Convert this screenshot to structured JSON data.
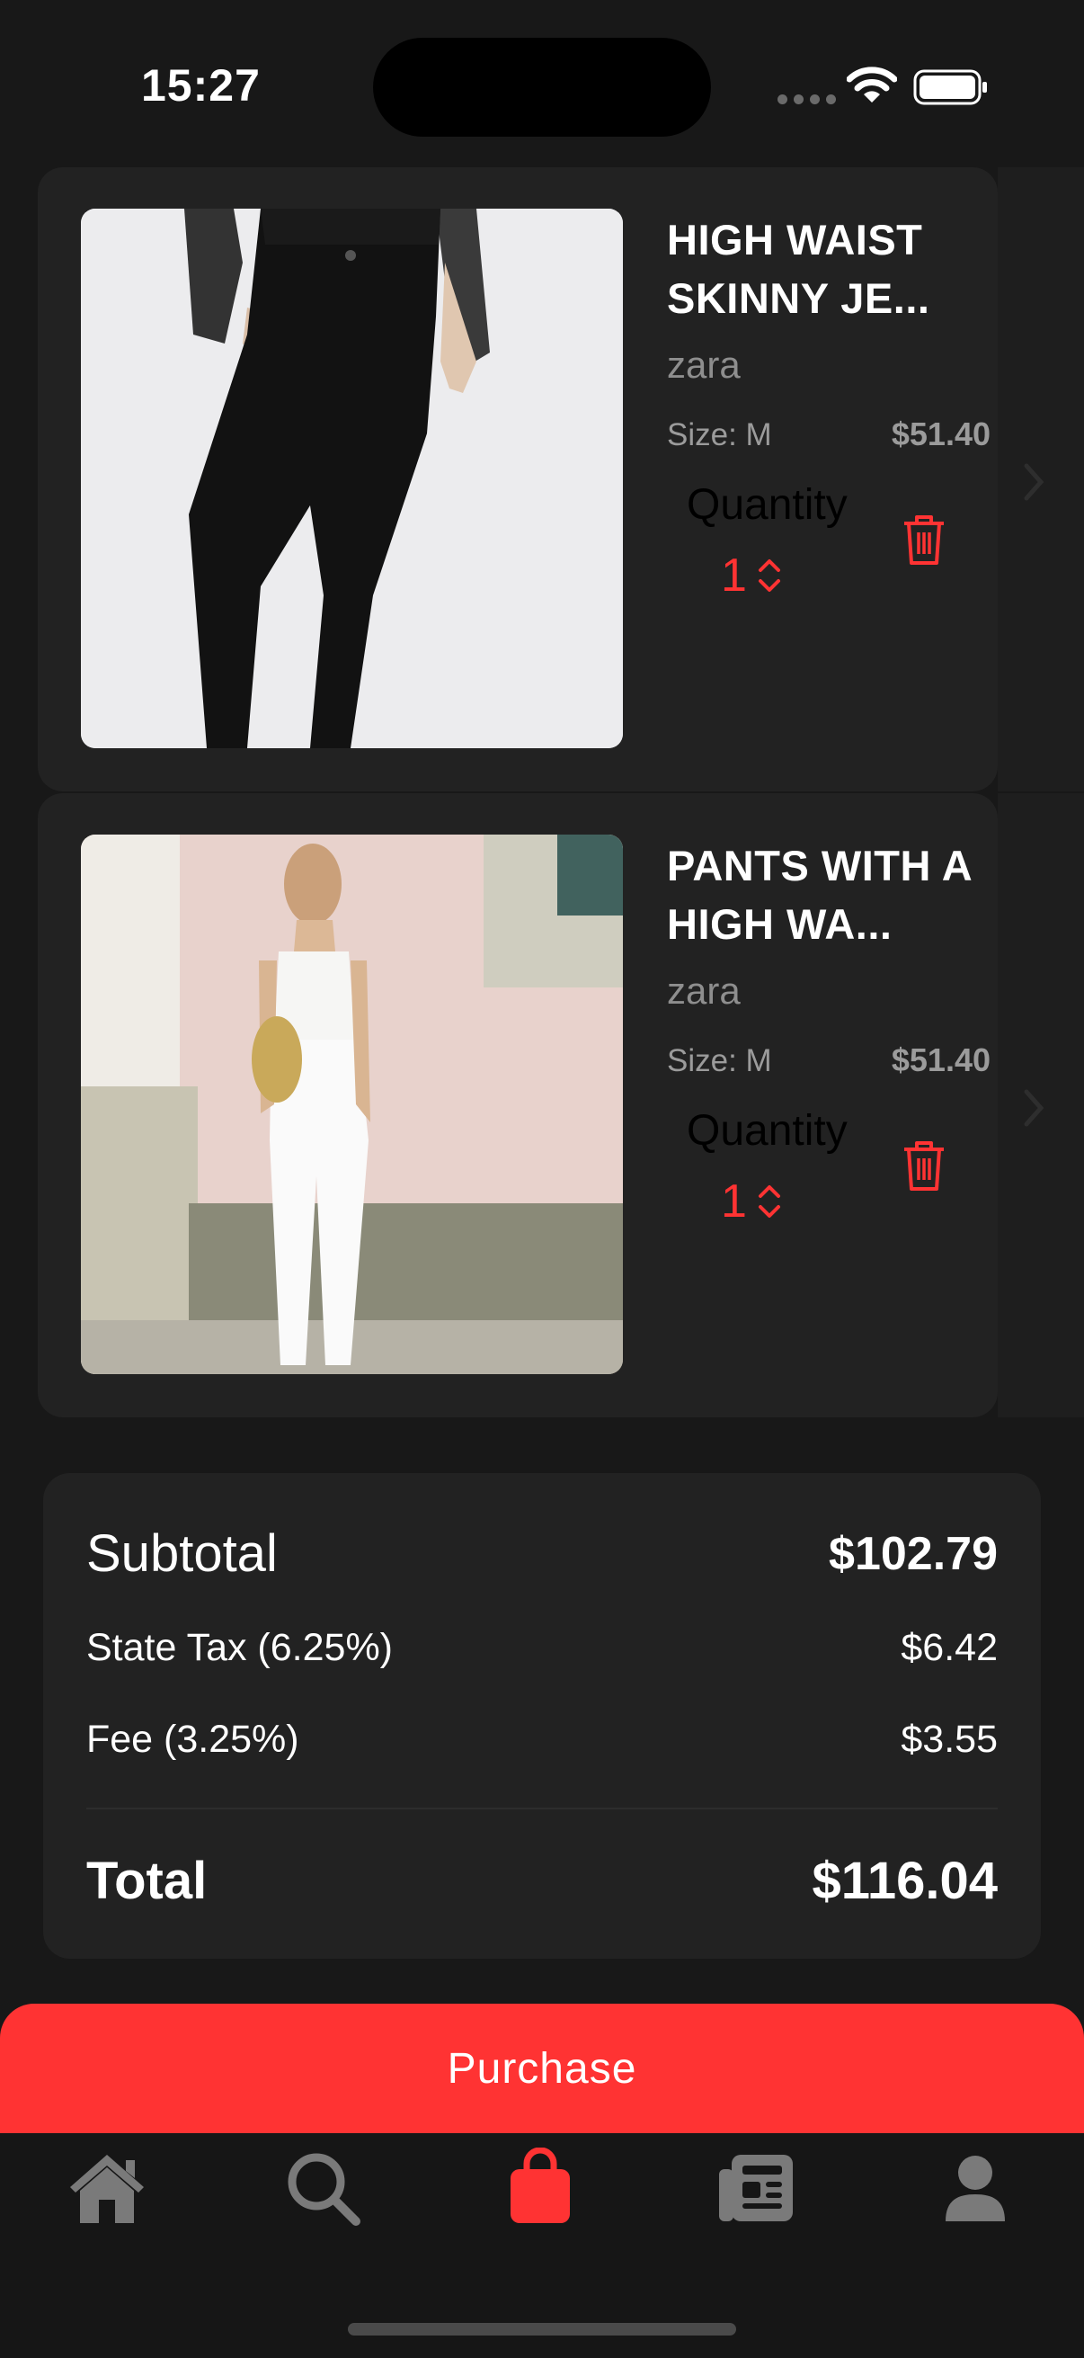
{
  "status_bar": {
    "time": "15:27"
  },
  "cart": {
    "items": [
      {
        "title": "HIGH WAIST SKINNY JE...",
        "brand": "zara",
        "size": "Size: M",
        "price": "$51.40",
        "quantity_label": "Quantity",
        "quantity": "1",
        "image": "woman-in-black-skinny-jeans"
      },
      {
        "title": "PANTS WITH A HIGH WA...",
        "brand": "zara",
        "size": "Size: M",
        "price": "$51.40",
        "quantity_label": "Quantity",
        "quantity": "1",
        "image": "woman-in-white-high-waist-pants"
      }
    ]
  },
  "summary": {
    "subtotal_label": "Subtotal",
    "subtotal_value": "$102.79",
    "tax_label": "State Tax (6.25%)",
    "tax_value": "$6.42",
    "fee_label": "Fee (3.25%)",
    "fee_value": "$3.55",
    "total_label": "Total",
    "total_value": "$116.04"
  },
  "purchase_label": "Purchase",
  "tabbar": {
    "tabs": [
      {
        "icon": "home-icon",
        "active": false
      },
      {
        "icon": "search-icon",
        "active": false
      },
      {
        "icon": "bag-icon",
        "active": true
      },
      {
        "icon": "news-icon",
        "active": false
      },
      {
        "icon": "profile-icon",
        "active": false
      }
    ]
  },
  "colors": {
    "accent": "#ff3333",
    "card": "#222222",
    "background": "#181818",
    "inactive_icon": "#7a7a7a"
  }
}
